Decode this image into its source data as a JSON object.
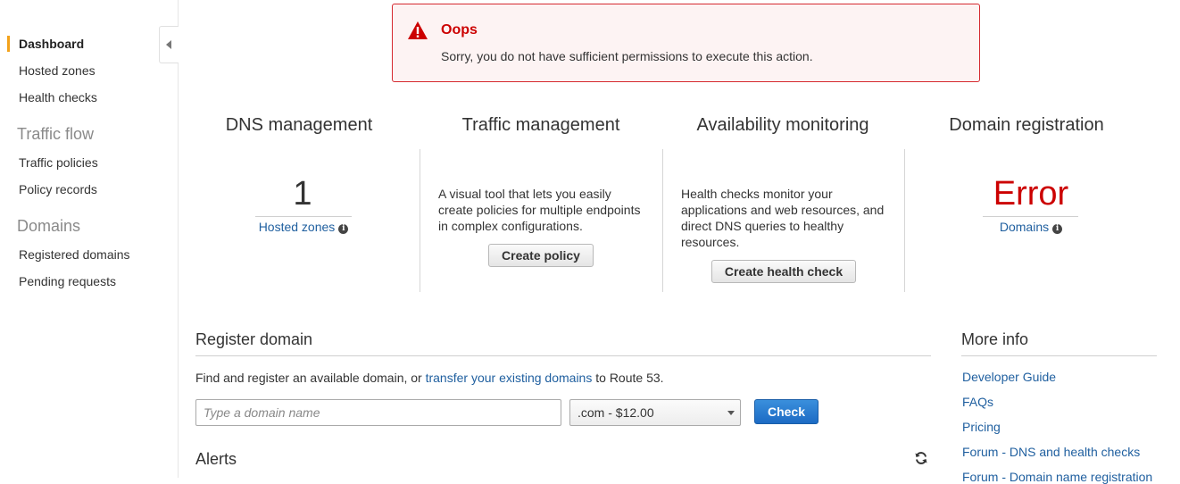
{
  "sidebar": {
    "items": [
      {
        "label": "Dashboard",
        "active": true
      },
      {
        "label": "Hosted zones"
      },
      {
        "label": "Health checks"
      }
    ],
    "traffic_flow": {
      "heading": "Traffic flow",
      "items": [
        {
          "label": "Traffic policies"
        },
        {
          "label": "Policy records"
        }
      ]
    },
    "domains": {
      "heading": "Domains",
      "items": [
        {
          "label": "Registered domains"
        },
        {
          "label": "Pending requests"
        }
      ]
    },
    "collapse_icon": "chevron-left-icon"
  },
  "error": {
    "title": "Oops",
    "message": "Sorry, you do not have sufficient permissions to execute this action.",
    "icon": "warning-triangle-icon",
    "color": "#cc0000"
  },
  "dashboard": {
    "dns": {
      "title": "DNS management",
      "count": "1",
      "link": "Hosted zones"
    },
    "traffic": {
      "title": "Traffic management",
      "description": "A visual tool that lets you easily create policies for multiple endpoints in complex configurations.",
      "button": "Create policy"
    },
    "availability": {
      "title": "Availability monitoring",
      "description": "Health checks monitor your applications and web resources, and direct DNS queries to healthy resources.",
      "button": "Create health check"
    },
    "domain_reg": {
      "title": "Domain registration",
      "status": "Error",
      "link": "Domains"
    }
  },
  "register": {
    "title": "Register domain",
    "intro_before": "Find and register an available domain, or",
    "intro_link": "transfer your existing domains",
    "intro_after": "to Route 53.",
    "placeholder": "Type a domain name",
    "tld_selected": ".com - $12.00",
    "check_button": "Check"
  },
  "alerts": {
    "title": "Alerts",
    "refresh_icon": "refresh-icon"
  },
  "more_info": {
    "title": "More info",
    "links": [
      "Developer Guide",
      "FAQs",
      "Pricing",
      "Forum - DNS and health checks",
      "Forum - Domain name registration"
    ]
  },
  "colors": {
    "accent": "#f3a21b",
    "link": "#1f5f9f",
    "primary_button": "#1c6bc4"
  }
}
